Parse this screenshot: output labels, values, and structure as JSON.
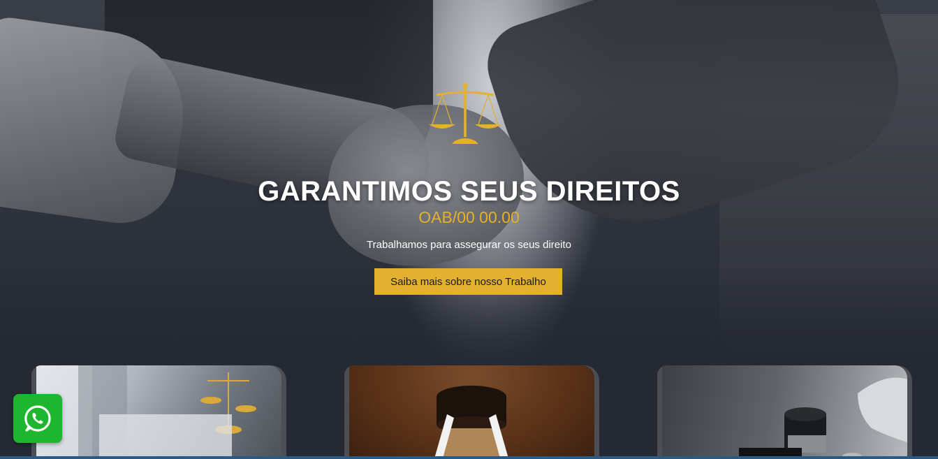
{
  "hero": {
    "title": "GARANTIMOS SEUS DIREITOS",
    "oab": "OAB/00 00.00",
    "subtitle": "Trabalhamos para assegurar os seus direito",
    "cta_label": "Saiba mais sobre nosso Trabalho",
    "icon": "scales-of-justice-icon"
  },
  "colors": {
    "accent_gold": "#e3b12e",
    "background": "#252932",
    "whatsapp_green": "#1fb62f"
  },
  "cards": [
    {
      "image": "scales-and-papers-photo"
    },
    {
      "image": "wooden-gavel-photo"
    },
    {
      "image": "gavel-and-coins-photo"
    }
  ],
  "floating": {
    "whatsapp_icon": "whatsapp-icon"
  }
}
